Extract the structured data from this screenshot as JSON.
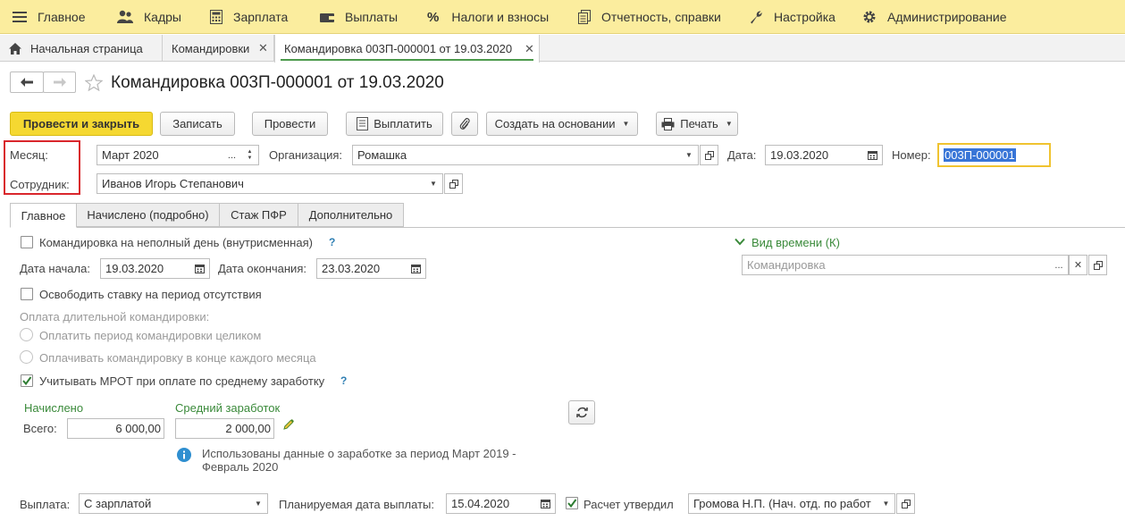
{
  "menu": {
    "items": [
      {
        "label": "Главное",
        "icon": "hamburger-icon"
      },
      {
        "label": "Кадры",
        "icon": "people-icon"
      },
      {
        "label": "Зарплата",
        "icon": "calculator-icon"
      },
      {
        "label": "Выплаты",
        "icon": "wallet-icon"
      },
      {
        "label": "Налоги и взносы",
        "icon": "percent-icon"
      },
      {
        "label": "Отчетность, справки",
        "icon": "reports-icon"
      },
      {
        "label": "Настройка",
        "icon": "wrench-icon"
      },
      {
        "label": "Администрирование",
        "icon": "gear-icon"
      }
    ]
  },
  "tabs": {
    "home": "Начальная страница",
    "trips": "Командировки",
    "current": "Командировка 003П-000001 от 19.03.2020"
  },
  "form": {
    "title": "Командировка 003П-000001 от 19.03.2020"
  },
  "toolbar": {
    "post_close": "Провести и закрыть",
    "save": "Записать",
    "post": "Провести",
    "pay": "Выплатить",
    "create_based": "Создать на основании",
    "print": "Печать"
  },
  "header": {
    "month_label": "Месяц:",
    "month_value": "Март 2020",
    "org_label": "Организация:",
    "org_value": "Ромашка",
    "date_label": "Дата:",
    "date_value": "19.03.2020",
    "number_label": "Номер:",
    "number_value": "003П-000001",
    "employee_label": "Сотрудник:",
    "employee_value": "Иванов Игорь Степанович"
  },
  "inner_tabs": {
    "main": "Главное",
    "accrued": "Начислено (подробно)",
    "pfr": "Стаж ПФР",
    "extra": "Дополнительно"
  },
  "main_tab": {
    "partial_day": "Командировка на неполный день (внутрисменная)",
    "help": "?",
    "start_label": "Дата начала:",
    "start_value": "19.03.2020",
    "end_label": "Дата окончания:",
    "end_value": "23.03.2020",
    "time_kind_label": "Вид времени (К)",
    "time_kind_value": "Командировка",
    "free_rate": "Освободить ставку на период отсутствия",
    "long_trip_label": "Оплата длительной командировки:",
    "pay_whole": "Оплатить период командировки целиком",
    "pay_monthly": "Оплачивать командировку в конце каждого месяца",
    "mrot": "Учитывать МРОТ при оплате по среднему заработку",
    "accrued_label": "Начислено",
    "avg_label": "Средний заработок",
    "total_label": "Всего:",
    "accrued_value": "6 000,00",
    "avg_value": "2 000,00",
    "info_text_1": "Использованы данные о заработке за период Март 2019 -",
    "info_text_2": "Февраль 2020",
    "payout_label": "Выплата:",
    "payout_value": "С зарплатой",
    "plan_date_label": "Планируемая дата выплаты:",
    "plan_date_value": "15.04.2020",
    "approved_label": "Расчет утвердил",
    "approver_value": "Громова Н.П. (Нач. отд. по работ"
  },
  "colors": {
    "menu_bg": "#fbed9e",
    "primary_button": "#f5d831",
    "highlight_box": "#d9262c",
    "focus_border": "#f0c330",
    "green_label": "#3a8a3a"
  }
}
